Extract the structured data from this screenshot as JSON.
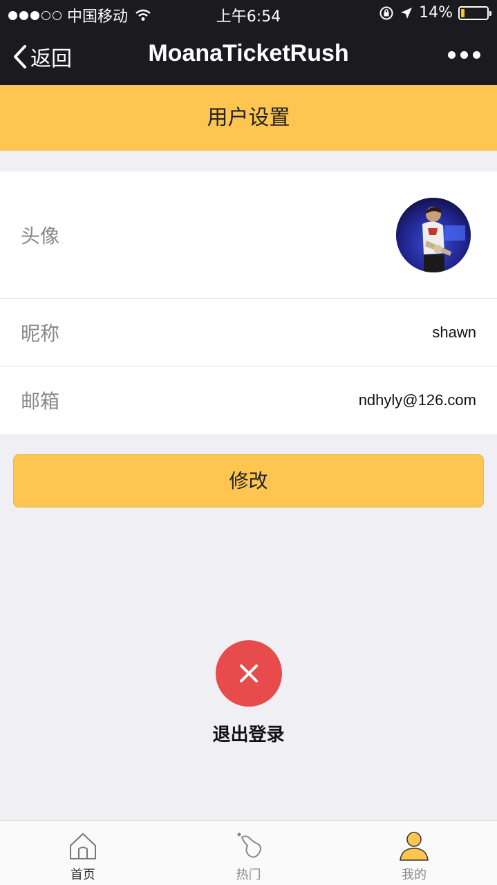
{
  "status_bar": {
    "carrier": "中国移动",
    "time": "上午6:54",
    "battery": "14%",
    "battery_level": 0.14
  },
  "nav": {
    "back_label": "返回",
    "title": "MoanaTicketRush"
  },
  "page": {
    "header": "用户设置"
  },
  "profile": {
    "avatar_label": "头像",
    "nickname_label": "昵称",
    "nickname_value": "shawn",
    "email_label": "邮箱",
    "email_value": "ndhyly@126.com"
  },
  "actions": {
    "edit_label": "修改",
    "logout_label": "退出登录"
  },
  "tabs": [
    {
      "label": "首页",
      "icon": "home-icon"
    },
    {
      "label": "热门",
      "icon": "hot-icon"
    },
    {
      "label": "我的",
      "icon": "user-icon"
    }
  ],
  "colors": {
    "accent": "#fec651",
    "dark_bar": "#1b1b1f",
    "logout": "#e84b4b",
    "background": "#efeff4"
  }
}
